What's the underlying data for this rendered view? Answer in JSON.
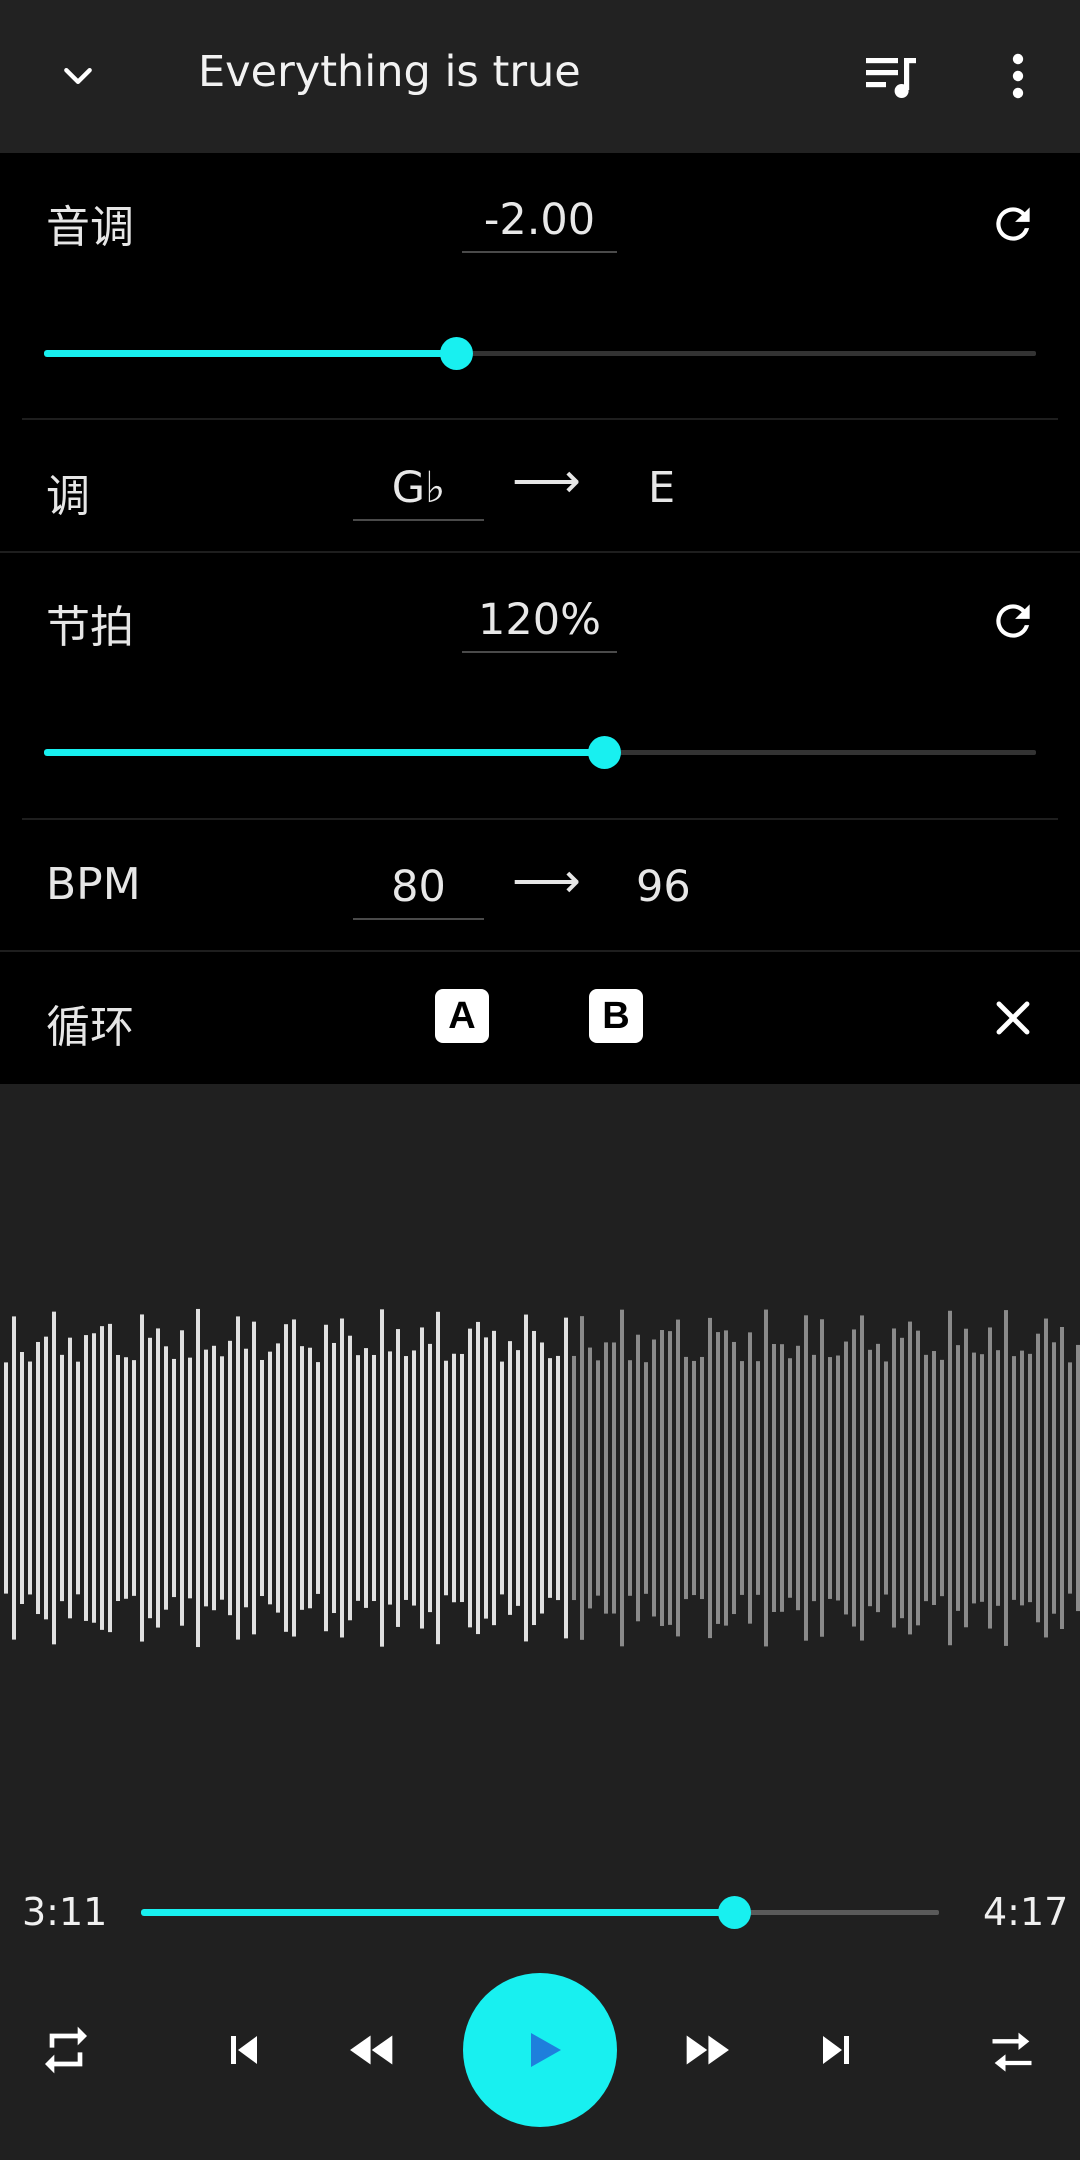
{
  "header": {
    "title": "Everything is true",
    "back_icon": "chevron-down-icon",
    "queue_icon": "queue-music-icon",
    "menu_icon": "more-vert-icon"
  },
  "pitch": {
    "label": "音调",
    "value": "-2.00",
    "slider_fraction": 0.415,
    "reset_icon": "refresh-icon"
  },
  "key": {
    "label": "调",
    "from": "G♭",
    "arrow": "⟶",
    "to": "E"
  },
  "tempo": {
    "label": "节拍",
    "value": "120%",
    "slider_fraction": 0.565,
    "reset_icon": "refresh-icon"
  },
  "bpm": {
    "label": "BPM",
    "from": "80",
    "arrow": "⟶",
    "to": "96"
  },
  "loop": {
    "label": "循环",
    "a_label": "A",
    "b_label": "B",
    "close_icon": "close-icon"
  },
  "playback": {
    "elapsed": "3:11",
    "total": "4:17",
    "progress_fraction": 0.743
  },
  "controls": {
    "repeat_icon": "repeat-icon",
    "prev_icon": "skip-previous-icon",
    "rewind_icon": "rewind-icon",
    "play_icon": "play-icon",
    "forward_icon": "fast-forward-icon",
    "next_icon": "skip-next-icon",
    "shuffle_icon": "shuffle-icon"
  },
  "colors": {
    "accent": "#18f0f0",
    "panel": "#000000",
    "background": "#202020",
    "wave_played": "#e0e0e0",
    "wave_unplayed": "#8a8a8a"
  }
}
